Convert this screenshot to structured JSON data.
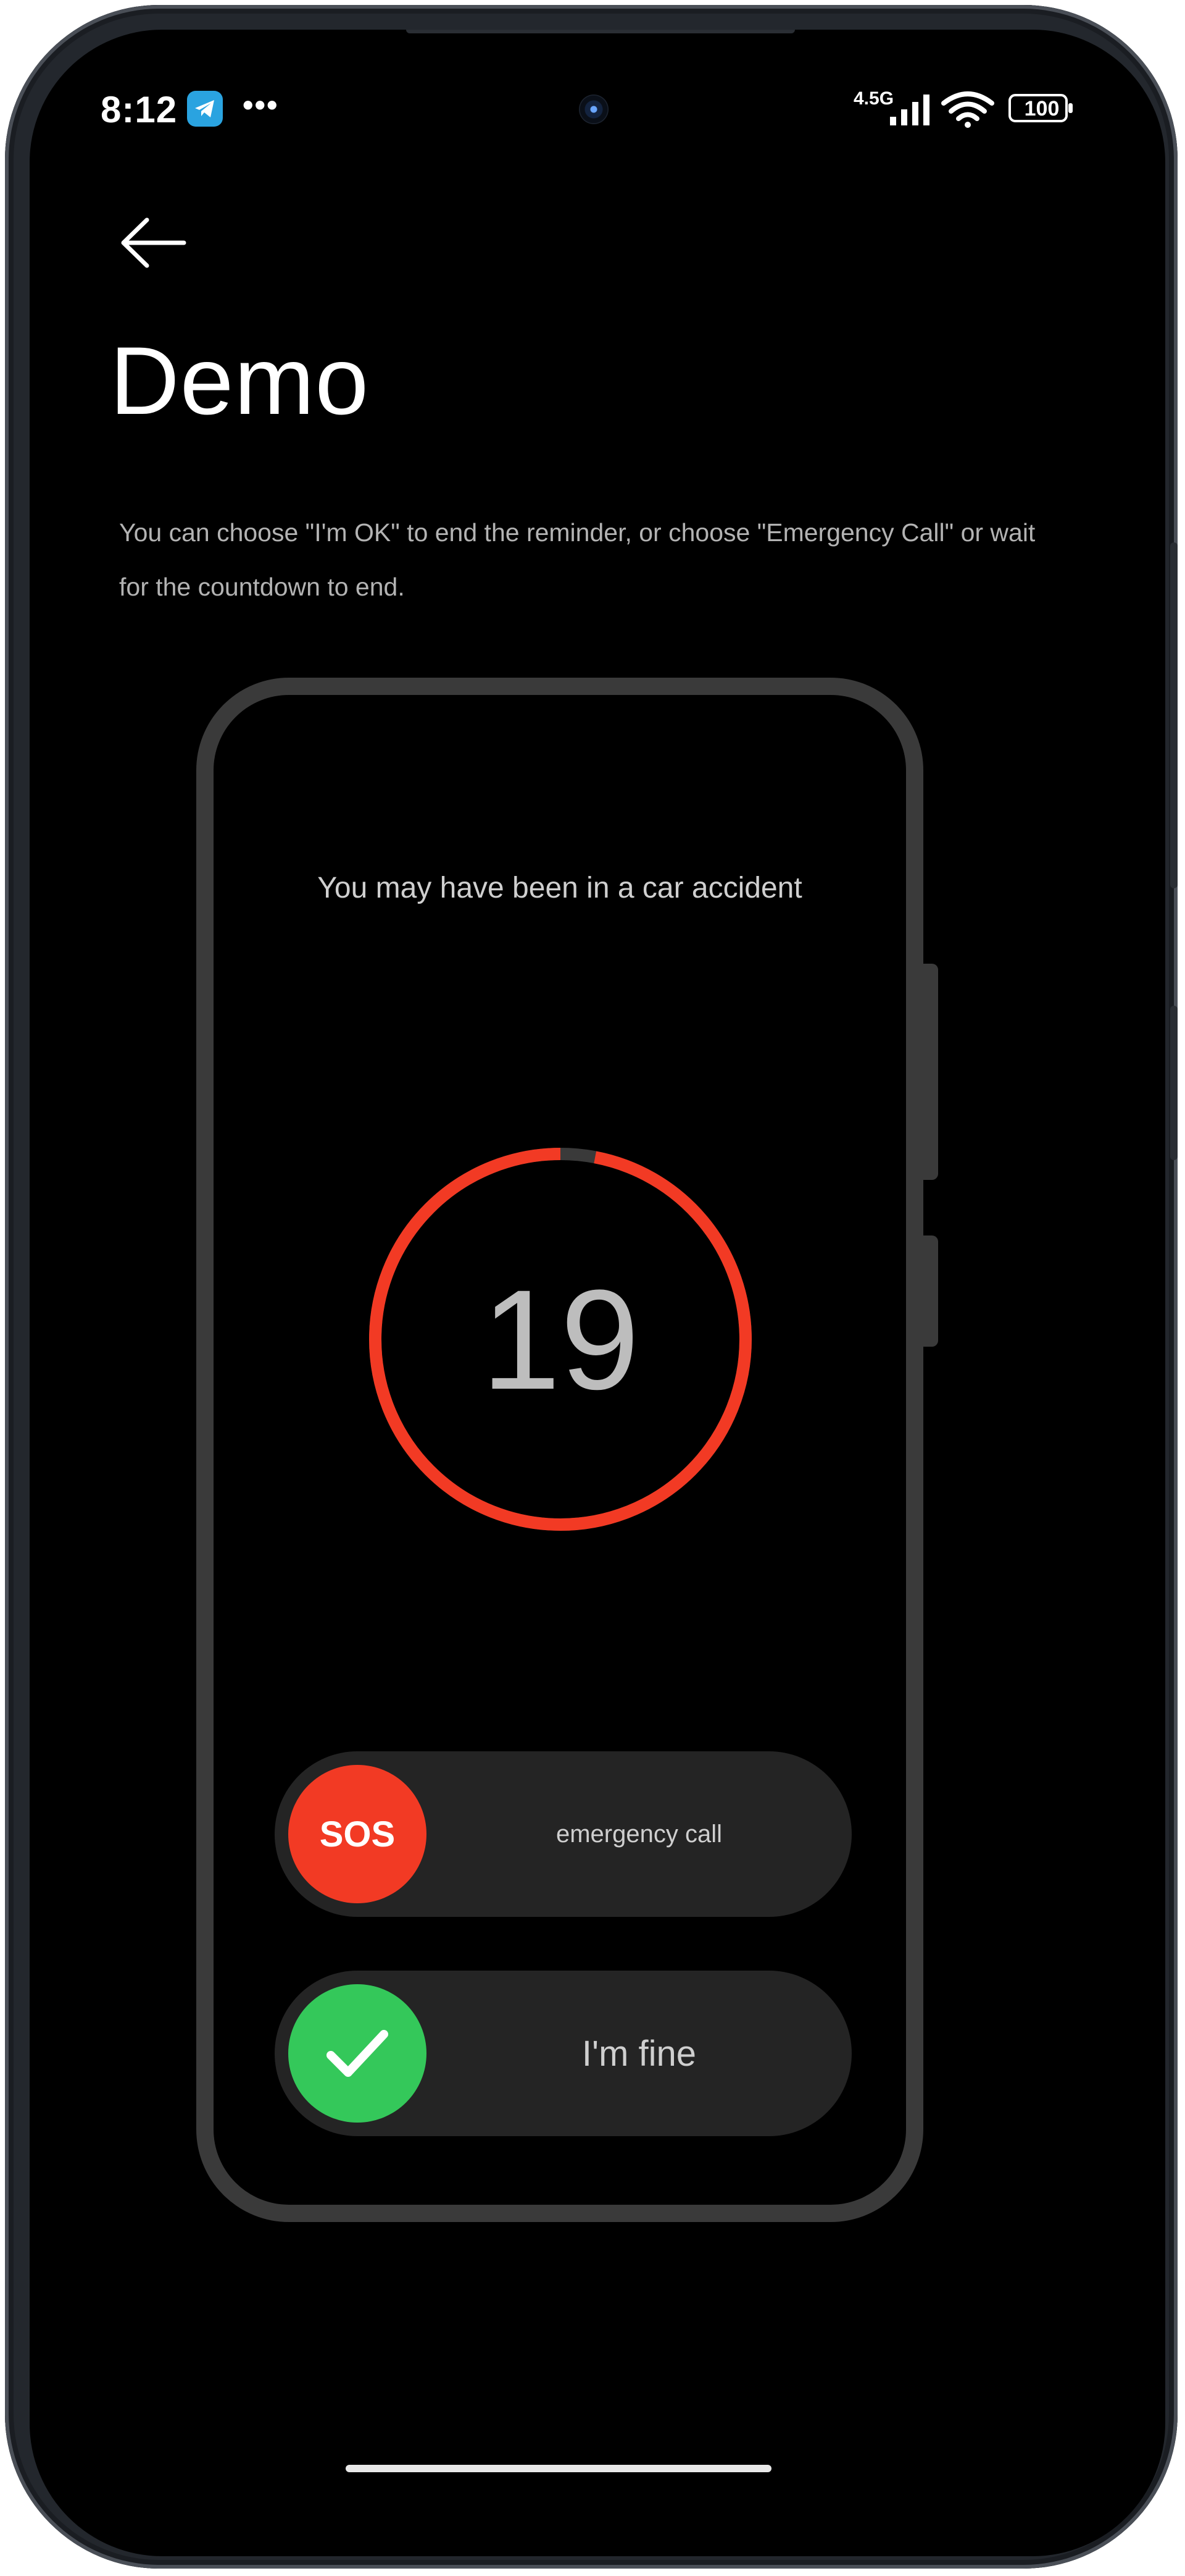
{
  "status_bar": {
    "time": "8:12",
    "network": "4.5G",
    "battery": "100",
    "more_dots": "•••"
  },
  "header": {
    "back_icon": "arrow-left-icon",
    "title": "Demo"
  },
  "description": "You can choose \"I'm OK\" to end the reminder, or choose \"Emergency Call\" or wait for the countdown to end.",
  "demo": {
    "alert_text": "You may have been in a car accident",
    "countdown": {
      "value": "19",
      "progress_fraction": 0.97,
      "ring_color": "#f23a24",
      "track_color": "#3a3a3a"
    },
    "sos_slider": {
      "knob_label": "SOS",
      "label": "emergency call",
      "color": "#f23a24"
    },
    "fine_slider": {
      "knob_icon": "check-icon",
      "label": "I'm fine",
      "color": "#34c85a"
    }
  }
}
